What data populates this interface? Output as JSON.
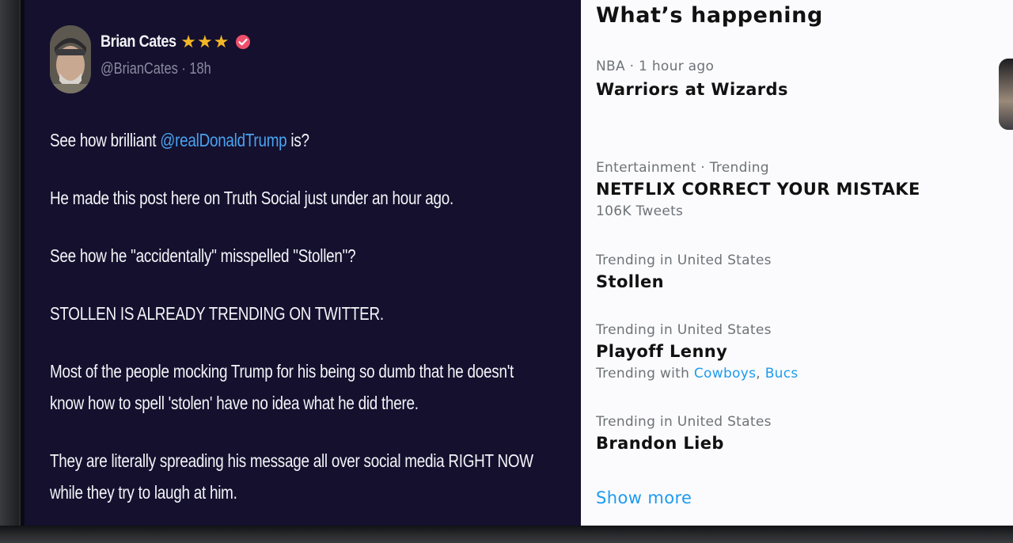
{
  "tweet": {
    "author_name": "Brian Cates",
    "star_count": 3,
    "handle_time": "@BrianCates · 18h",
    "lines": {
      "l1_pre": "See how brilliant ",
      "l1_mention": "@realDonaldTrump",
      "l1_post": " is?",
      "l2": "He made this post here on Truth Social just under an hour ago.",
      "l3": "See how he \"accidentally\" misspelled \"Stollen\"?",
      "l4": "STOLLEN IS ALREADY TRENDING ON TWITTER.",
      "l5a": "Most of the people mocking Trump for his being so dumb that he doesn't",
      "l5b": "know how to spell 'stolen' have no idea what he did there.",
      "l6a": "They are literally spreading his message all over social media RIGHT NOW",
      "l6b": "while they try to laugh at him."
    },
    "colors": {
      "background": "#14102e",
      "mention": "#4aa3f0",
      "stars": "#f3b625",
      "verified": "#ef4f6a"
    }
  },
  "trends": {
    "title": "What’s happening",
    "items": [
      {
        "meta": "NBA · 1 hour ago",
        "name": "Warriors at Wizards"
      },
      {
        "meta": "Entertainment · Trending",
        "name": "NETFLIX CORRECT YOUR MISTAKE",
        "sub": "106K Tweets"
      },
      {
        "meta": "Trending in United States",
        "name": "Stollen"
      },
      {
        "meta": "Trending in United States",
        "name": "Playoff Lenny",
        "sub_prefix": "Trending with ",
        "sub_link1": "Cowboys",
        "sub_sep": ", ",
        "sub_link2": "Bucs"
      },
      {
        "meta": "Trending in United States",
        "name": "Brandon Lieb"
      }
    ],
    "show_more": "Show more",
    "colors": {
      "link": "#1d9bf0",
      "meta": "#6e7378"
    }
  }
}
